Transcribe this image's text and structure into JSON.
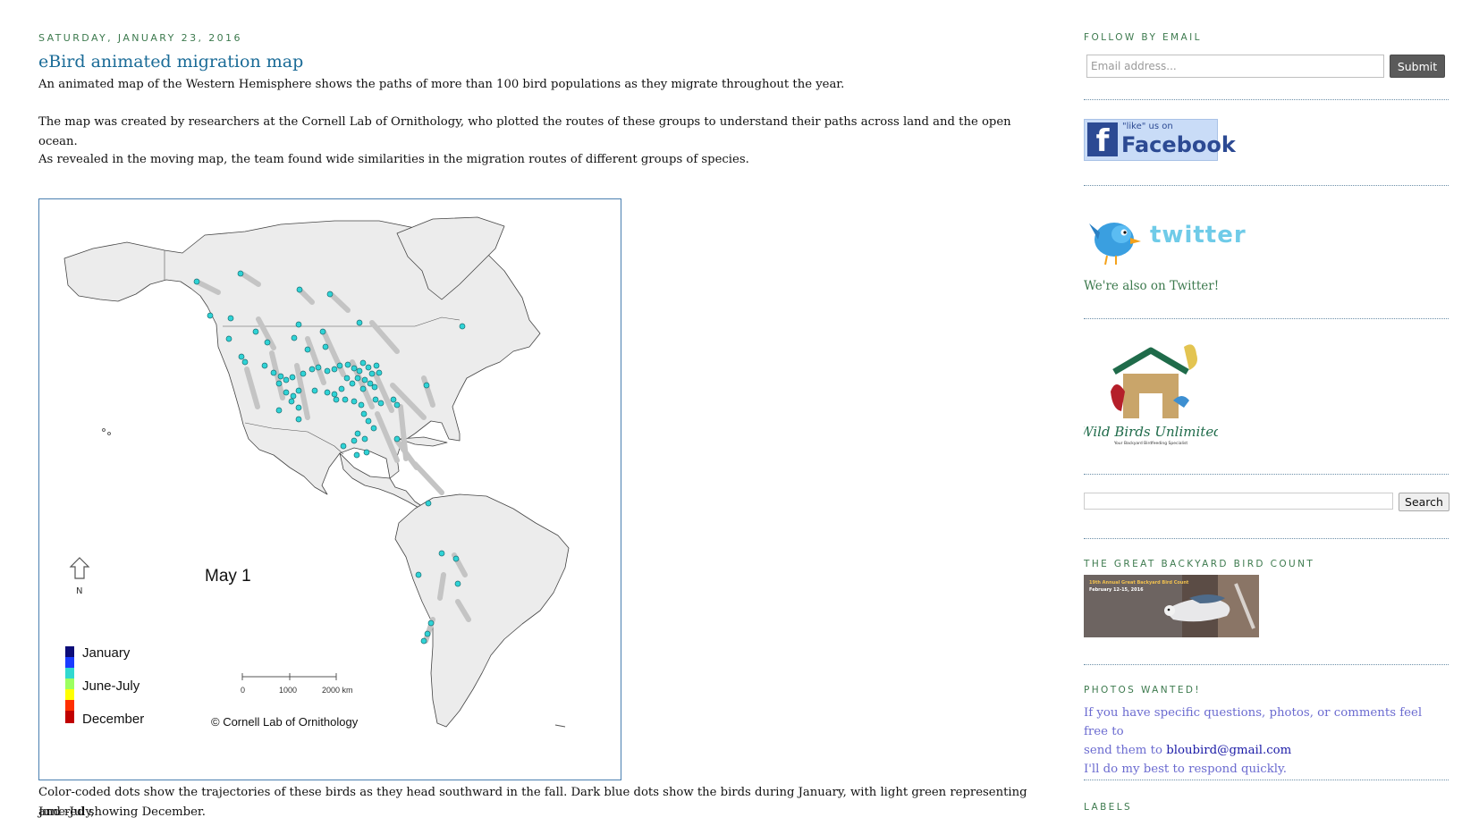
{
  "post": {
    "date": "Saturday, January 23, 2016",
    "title": "eBird animated migration map",
    "paragraphs": [
      "An animated map of the Western Hemisphere shows the paths of more than 100 bird populations as they migrate throughout the year.",
      "The map was created by researchers at the Cornell Lab of Ornithology, who plotted the routes of these groups to understand their paths across land and the open ocean.",
      "As revealed in the moving map, the team found wide similarities in the migration routes of different groups of species."
    ],
    "caption_line1": "Color-coded dots show the trajectories of these birds as they head southward in the fall. Dark blue dots show the birds during January, with light green representing June-July,",
    "caption_line2": "and red showing December."
  },
  "map": {
    "frame_label": "May 1",
    "north_label": "N",
    "legend": [
      "January",
      "June-July",
      "December"
    ],
    "legend_colors": [
      "#0c0c78",
      "#1a3cff",
      "#30d8d0",
      "#9cff60",
      "#ffff00",
      "#ff3000",
      "#c00000"
    ],
    "scale_labels": [
      "0",
      "1000",
      "2000 km"
    ],
    "copyright": "© Cornell Lab of Ornithology",
    "dot_color": "#2fd3d6",
    "trail_color": "#c4c4c4"
  },
  "sidebar": {
    "follow_heading": "Follow by Email",
    "email_placeholder": "Email address...",
    "submit_label": "Submit",
    "facebook_small": "\"like\" us on",
    "facebook_word": "Facebook",
    "twitter_word": "twitter",
    "twitter_caption": "We're also on Twitter!",
    "wbu_brand": "Wild Birds Unlimited",
    "wbu_tagline": "Your Backyard Birdfeeding Specialist",
    "search_label": "Search",
    "gbbc_heading": "The Great Backyard Bird Count",
    "gbbc_img_title": "19th Annual Great Backyard Bird Count",
    "gbbc_img_dates": "February 12-15, 2016",
    "photos_heading": "Photos Wanted!",
    "photos_line1": "If you have specific questions, photos, or comments feel free to",
    "photos_line2_prefix": "send them to ",
    "photos_email": "bloubird@gmail.com",
    "photos_line3": "I'll do my best to respond quickly.",
    "labels_heading": "Labels"
  }
}
